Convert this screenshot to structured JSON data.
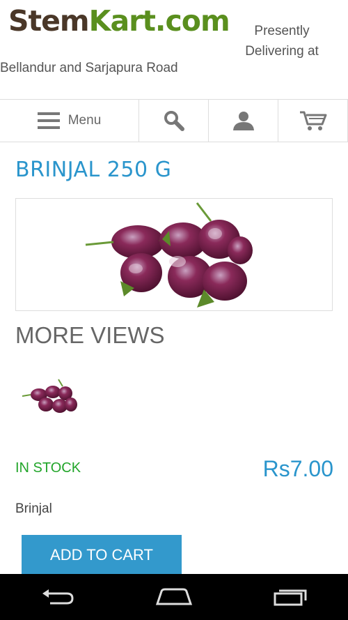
{
  "header": {
    "logo_stem": "Stem",
    "logo_kart": "Kart.com",
    "tagline_line1": "Presently",
    "tagline_line2": "Delivering at",
    "tagline_line3": "Bellandur and Sarjapura Road"
  },
  "nav": {
    "menu_label": "Menu",
    "icons": [
      "hamburger-icon",
      "search-icon",
      "account-icon",
      "cart-icon"
    ]
  },
  "product": {
    "title": "BRINJAL 250 G",
    "more_views_label": "MORE VIEWS",
    "stock_status": "IN STOCK",
    "price": "Rs7.00",
    "description": "Brinjal",
    "add_to_cart_label": "ADD TO CART"
  },
  "system_nav": {
    "icons": [
      "back-icon",
      "home-icon",
      "recent-apps-icon"
    ]
  },
  "colors": {
    "accent": "#2a95cc",
    "button": "#3399cc",
    "in_stock": "#22a52a",
    "logo_brown": "#4a3728",
    "logo_green": "#5a8f1e"
  }
}
